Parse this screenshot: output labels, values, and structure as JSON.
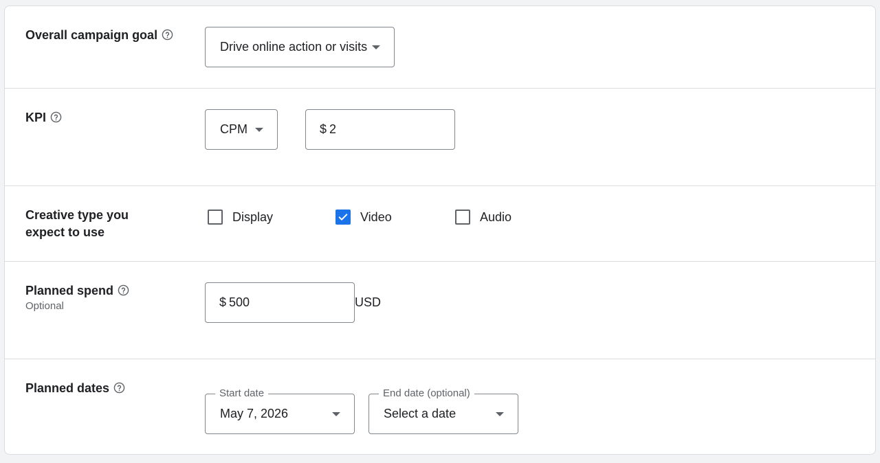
{
  "goal": {
    "label": "Overall campaign goal",
    "help_icon": "help-circle-icon",
    "selected": "Drive online action or visits"
  },
  "kpi": {
    "label": "KPI",
    "help_icon": "help-circle-icon",
    "metric_selected": "CPM",
    "currency_symbol": "$",
    "value": "2"
  },
  "creative": {
    "label_line1": "Creative type you",
    "label_line2": "expect to use",
    "options": [
      {
        "label": "Display",
        "checked": false
      },
      {
        "label": "Video",
        "checked": true
      },
      {
        "label": "Audio",
        "checked": false
      }
    ]
  },
  "spend": {
    "label": "Planned spend",
    "help_icon": "help-circle-icon",
    "sublabel": "Optional",
    "currency_symbol": "$",
    "value": "500",
    "unit": "USD"
  },
  "dates": {
    "label": "Planned dates",
    "help_icon": "help-circle-icon",
    "start_label": "Start date",
    "start_value": "May 7, 2026",
    "end_label": "End date (optional)",
    "end_value": "Select a date"
  },
  "colors": {
    "accent": "#1a73e8",
    "border": "#dadce0",
    "field_border": "#80868b"
  }
}
